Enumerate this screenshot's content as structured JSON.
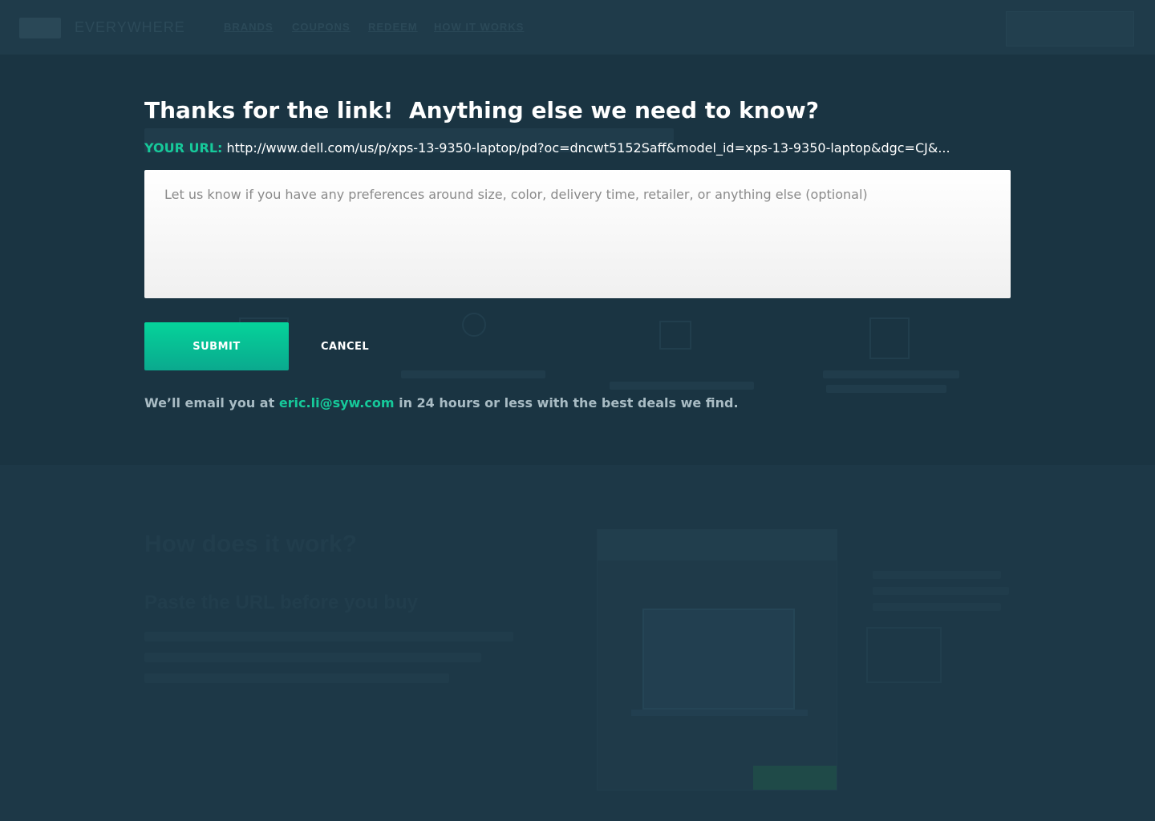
{
  "background": {
    "brand": "EVERYWHERE",
    "nav_links": [
      "BRANDS",
      "COUPONS",
      "REDEEM",
      "HOW IT WORKS"
    ],
    "section_title": "How does it work?",
    "section_subtitle": "Paste the URL before you buy"
  },
  "modal": {
    "title": "Thanks for the link!  Anything else we need to know?",
    "url_label": "YOUR URL:",
    "url_value": "http://www.dell.com/us/p/xps-13-9350-laptop/pd?oc=dncwt5152Saff&model_id=xps-13-9350-laptop&dgc=CJ&...",
    "textarea_placeholder": "Let us know if you have any preferences around size, color, delivery time, retailer, or anything else (optional)",
    "submit_label": "SUBMIT",
    "cancel_label": "CANCEL",
    "notice_prefix": "We’ll email you at ",
    "notice_email": "eric.li@syw.com",
    "notice_suffix": " in 24 hours or less with the best deals we find."
  },
  "colors": {
    "accent": "#16c99a",
    "background": "#1c3543",
    "text_muted": "#a9bcc4"
  }
}
